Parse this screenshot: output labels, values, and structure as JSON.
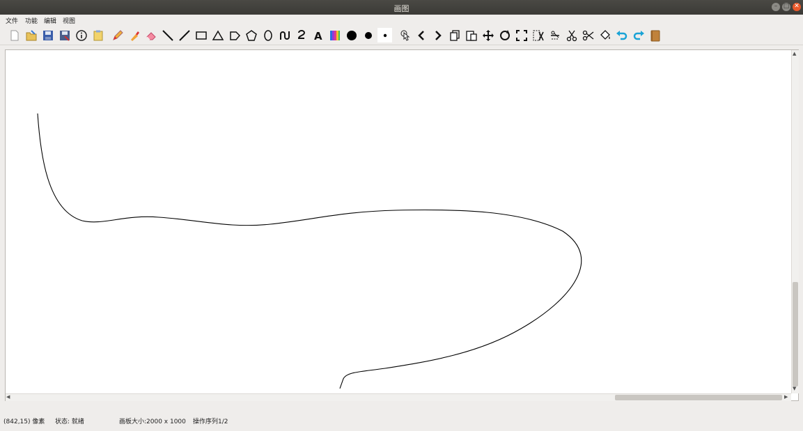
{
  "window": {
    "title": "画图"
  },
  "menu": {
    "items": [
      "文件",
      "功能",
      "编辑",
      "视图"
    ]
  },
  "toolbar": {
    "tools": [
      "new-file-icon",
      "open-file-icon",
      "save-icon",
      "save-as-icon",
      "info-icon",
      "paste-icon",
      "pencil-icon",
      "brush-icon",
      "eraser-icon",
      "line-icon",
      "line-alt-icon",
      "rectangle-icon",
      "triangle-icon",
      "pentagon-icon",
      "polygon-icon",
      "ellipse-icon",
      "curve-icon",
      "bezier-icon",
      "text-icon",
      "color-palette-icon",
      "pen-size-large-icon",
      "pen-size-medium-icon",
      "pen-size-small-icon",
      "select-pointer-icon",
      "previous-icon",
      "next-icon",
      "copy-icon",
      "paste-clipboard-icon",
      "move-icon",
      "rotate-icon",
      "fullscreen-icon",
      "crop-icon",
      "strike-icon",
      "cut-icon",
      "scissors-icon",
      "fill-bucket-icon",
      "undo-icon",
      "redo-icon",
      "notebook-icon"
    ]
  },
  "status": {
    "coords": "(842,15) 像素",
    "state": "状态: 就绪",
    "canvas_size": "画板大小:2000 x 1000",
    "op_sequence": "操作序列1/2"
  }
}
